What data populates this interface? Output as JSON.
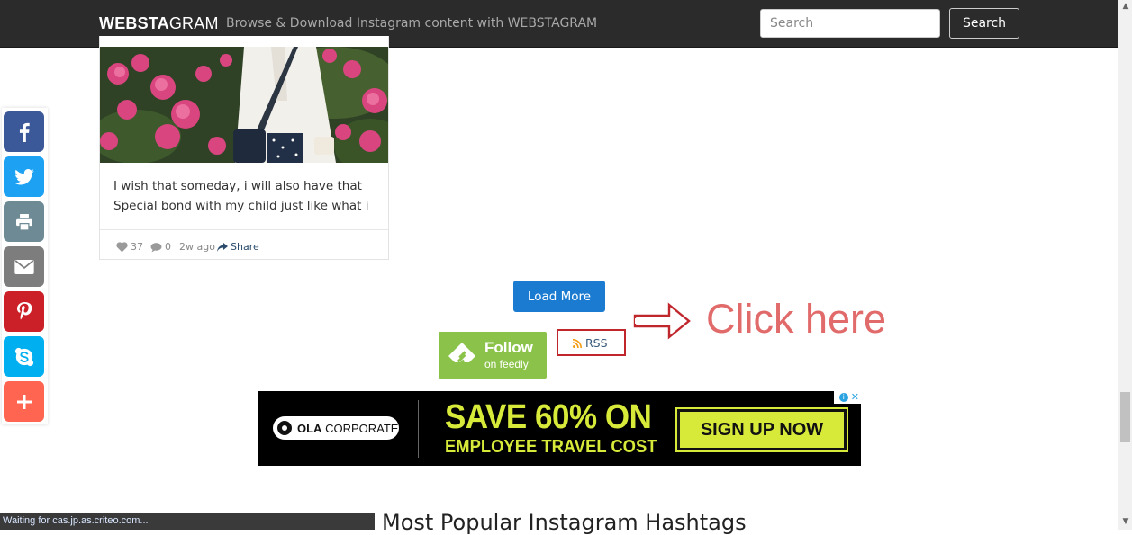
{
  "header": {
    "brand_bold": "WEBSTA",
    "brand_rest": "GRAM",
    "tagline": "Browse & Download Instagram content with WEBSTAGRAM",
    "search_placeholder": "Search",
    "search_button": "Search"
  },
  "post": {
    "caption_line1": "I wish that someday, i will also have that",
    "caption_line2": "Special bond with my child just like what i",
    "likes": "37",
    "comments": "0",
    "time": "2w ago",
    "share_label": "Share"
  },
  "social": {
    "buttons": [
      {
        "name": "facebook",
        "color": "#3b5998"
      },
      {
        "name": "twitter",
        "color": "#1da1f2"
      },
      {
        "name": "print",
        "color": "#6d8a95"
      },
      {
        "name": "email",
        "color": "#7d7d7d"
      },
      {
        "name": "pinterest",
        "color": "#cb2027"
      },
      {
        "name": "skype",
        "color": "#00aff0"
      },
      {
        "name": "more",
        "color": "#ff6550"
      }
    ]
  },
  "actions": {
    "load_more": "Load More",
    "feedly_follow": "Follow",
    "feedly_sub": "on feedly",
    "rss": "RSS",
    "annotation": "Click here"
  },
  "ad": {
    "brand_bold": "OLA",
    "brand_rest": "CORPORATE",
    "headline": "SAVE 60% ON",
    "subline": "EMPLOYEE TRAVEL COST",
    "cta": "SIGN UP NOW"
  },
  "section": {
    "heading": "Most Popular Instagram Hashtags"
  },
  "status": {
    "text": "Waiting for cas.jp.as.criteo.com..."
  },
  "colors": {
    "navbar": "#2b2b2b",
    "primary_button": "#1a7bd1",
    "feedly_green": "#8bc34a",
    "annotation_red": "#c0272d",
    "ad_yellow": "#d7ea3a"
  }
}
